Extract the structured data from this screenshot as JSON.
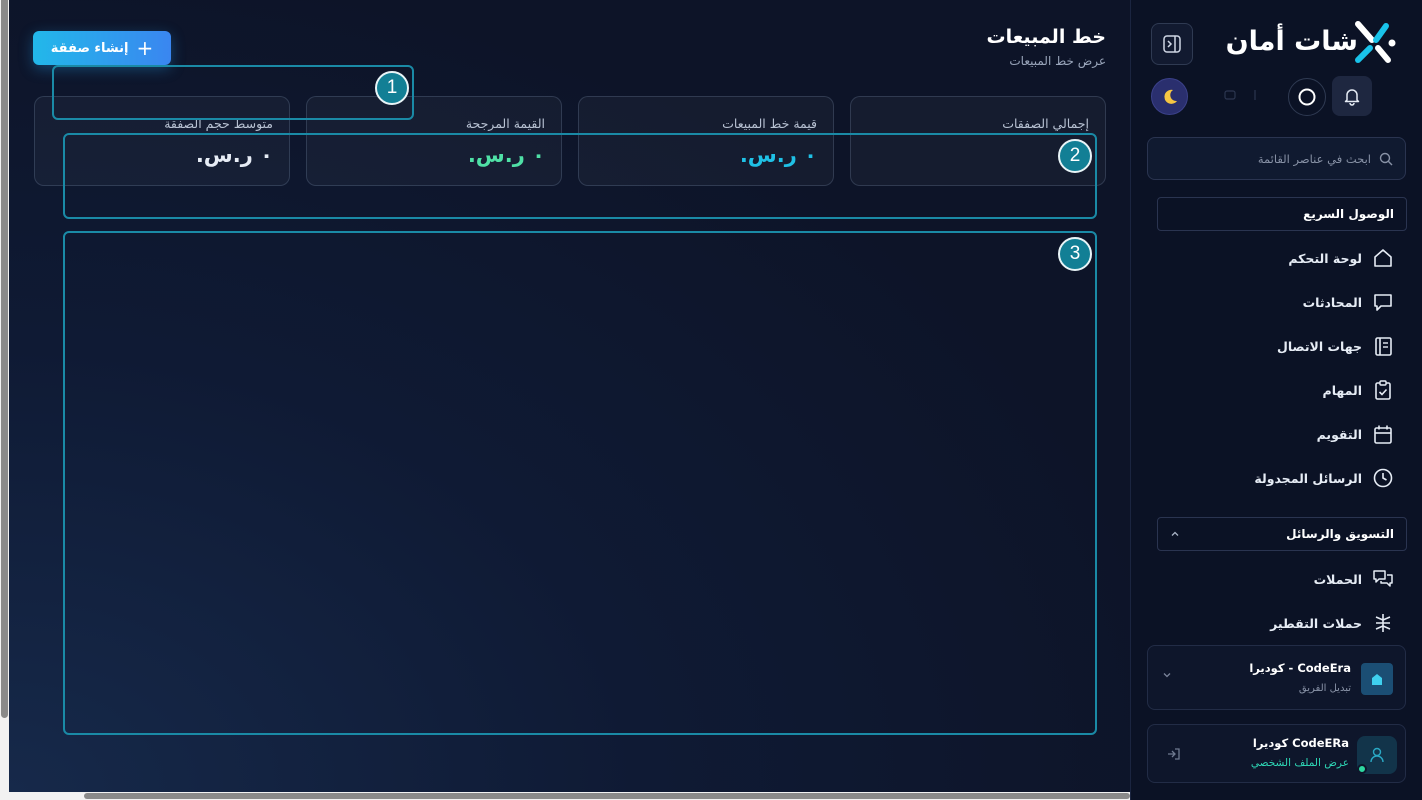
{
  "header": {
    "title": "خط المبيعات",
    "subtitle": "عرض خط المبيعات",
    "create_button_label": "إنشاء صفقة"
  },
  "stats": [
    {
      "label": "إجمالي الصفقات",
      "value": "",
      "color": "#ffffff"
    },
    {
      "label": "قيمة خط المبيعات",
      "value": "٠ ر.س.",
      "color": "#1fc1e6"
    },
    {
      "label": "القيمة المرجحة",
      "value": "٠ ر.س.",
      "color": "#4fe0a6"
    },
    {
      "label": "متوسط حجم الصفقة",
      "value": "٠ ر.س.",
      "color": "#ffffff"
    }
  ],
  "annotations": [
    "1",
    "2",
    "3"
  ],
  "sidebar": {
    "logo_text": "شات أمان",
    "search_placeholder": "ابحث في عناصر القائمة",
    "quick_access_label": "الوصول السريع",
    "quick_items": [
      {
        "label": "لوحة التحكم",
        "icon": "home-icon"
      },
      {
        "label": "المحادثات",
        "icon": "chat-icon"
      },
      {
        "label": "جهات الاتصال",
        "icon": "contacts-icon"
      },
      {
        "label": "المهام",
        "icon": "clipboard-check-icon"
      },
      {
        "label": "التقويم",
        "icon": "calendar-icon"
      },
      {
        "label": "الرسائل المجدولة",
        "icon": "clock-icon"
      }
    ],
    "marketing_label": "التسويق والرسائل",
    "marketing_items": [
      {
        "label": "الحملات",
        "icon": "campaigns-icon"
      },
      {
        "label": "حملات التقطير",
        "icon": "drip-icon"
      }
    ],
    "team": {
      "name": "كوديرا - CodeEra",
      "sub": "تبديل الفريق"
    },
    "profile": {
      "name": "كوديرا CodeERa",
      "link": "عرض الملف الشخصي"
    }
  },
  "colors": {
    "accent": "#22b8ea",
    "annotation": "#1a8aa6",
    "online": "#2ed8a0"
  }
}
